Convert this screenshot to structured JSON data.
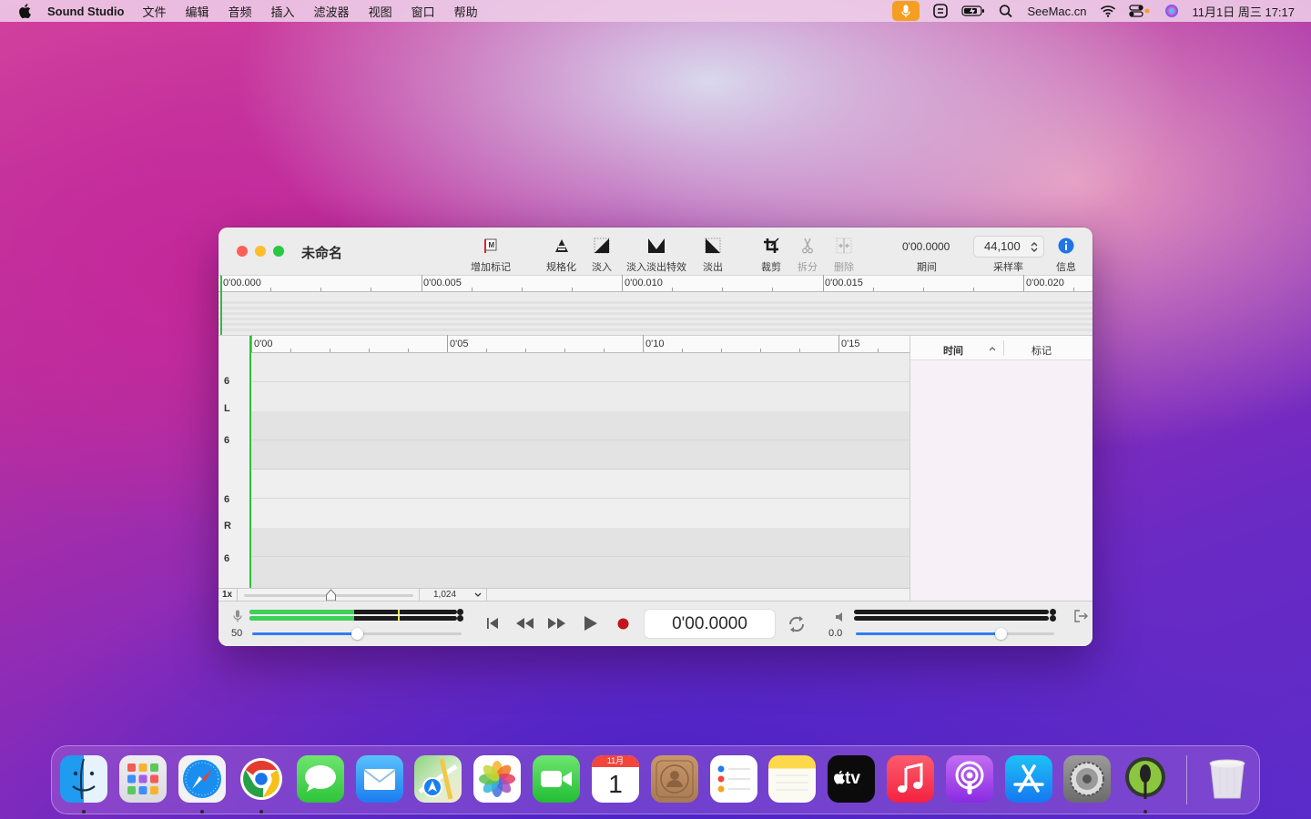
{
  "menubar": {
    "app_name": "Sound Studio",
    "menus": [
      "文件",
      "编辑",
      "音频",
      "插入",
      "滤波器",
      "视图",
      "窗口",
      "帮助"
    ],
    "site": "SeeMac.cn",
    "datetime": "11月1日 周三  17:17"
  },
  "window": {
    "title": "未命名",
    "toolbar": {
      "add_marker": "增加标记",
      "normalize": "规格化",
      "fade_in": "淡入",
      "crossfade": "淡入淡出特效",
      "fade_out": "淡出",
      "crop": "裁剪",
      "split": "拆分",
      "delete": "删除",
      "duration_value": "0'00.0000",
      "duration_label": "期间",
      "sample_rate_value": "44,100",
      "sample_rate_label": "采样率",
      "info_label": "信息"
    },
    "overview_ruler": [
      "0'00.000",
      "0'00.005",
      "0'00.010",
      "0'00.015",
      "0'00.020"
    ],
    "editor_ruler": [
      "0'00",
      "0'05",
      "0'10",
      "0'15"
    ],
    "channel_labels": {
      "l_top": "6",
      "l": "L",
      "l_bottom": "6",
      "r_top": "6",
      "r": "R",
      "r_bottom": "6"
    },
    "zoom_label": "1x",
    "zoom_select": "1,024",
    "markers_panel": {
      "col_time": "时间",
      "col_marker": "标记"
    },
    "transport": {
      "input_level": "50",
      "input_slider_fraction": 0.5,
      "timecode": "0'00.0000",
      "output_level": "0.0",
      "output_slider_fraction": 0.73
    }
  },
  "dock": {
    "apps": [
      "finder-icon",
      "launchpad-icon",
      "safari-icon",
      "chrome-icon",
      "messages-icon",
      "mail-icon",
      "maps-icon",
      "photos-icon",
      "facetime-icon",
      "calendar-icon",
      "contacts-icon",
      "reminders-icon",
      "notes-icon",
      "appletv-icon",
      "music-icon",
      "podcasts-icon",
      "appstore-icon",
      "system-preferences-icon",
      "sound-studio-icon",
      "trash-icon"
    ],
    "calendar_month": "11月",
    "calendar_day": "1",
    "tv_label": "tv"
  }
}
